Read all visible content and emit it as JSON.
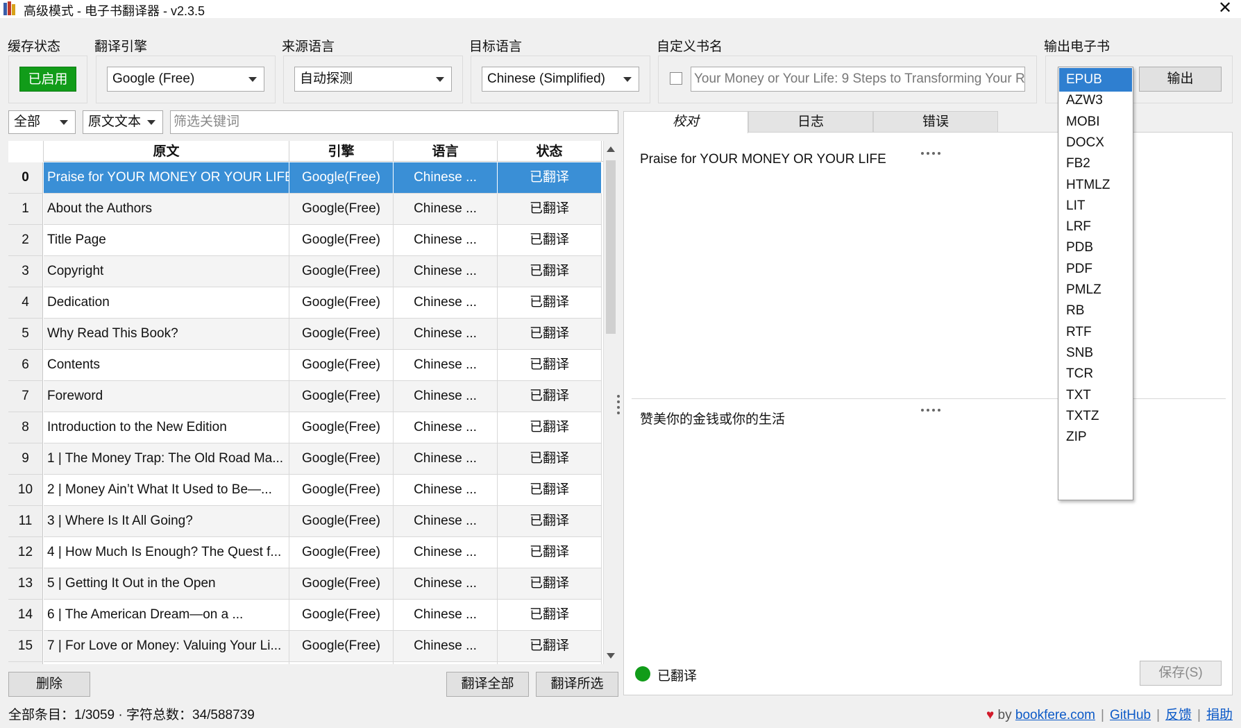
{
  "window": {
    "title": "高级模式 - 电子书翻译器 - v2.3.5",
    "close_symbol": "✕"
  },
  "cache": {
    "label": "缓存状态",
    "button": "已启用",
    "color": "#119c19"
  },
  "engine": {
    "label": "翻译引擎",
    "value": "Google (Free)"
  },
  "source_lang": {
    "label": "来源语言",
    "value": "自动探测"
  },
  "target_lang": {
    "label": "目标语言",
    "value": "Chinese (Simplified)"
  },
  "custom_title": {
    "label": "自定义书名",
    "checked": false,
    "value": "Your Money or Your Life: 9 Steps to Transforming Your R"
  },
  "output": {
    "label": "输出电子书",
    "selected_format": "EPUB",
    "button": "输出",
    "formats": [
      "EPUB",
      "AZW3",
      "MOBI",
      "DOCX",
      "FB2",
      "HTMLZ",
      "LIT",
      "LRF",
      "PDB",
      "PDF",
      "PMLZ",
      "RB",
      "RTF",
      "SNB",
      "TCR",
      "TXT",
      "TXTZ",
      "ZIP"
    ]
  },
  "filters": {
    "scope": "全部",
    "field": "原文文本",
    "placeholder": "筛选关键词"
  },
  "table": {
    "headers": {
      "source": "原文",
      "engine": "引擎",
      "language": "语言",
      "status": "状态"
    },
    "selected_row": 0,
    "rows": [
      {
        "idx": "0",
        "source": "Praise for YOUR MONEY OR YOUR LIFE",
        "engine": "Google(Free)",
        "language": "Chinese ...",
        "status": "已翻译"
      },
      {
        "idx": "1",
        "source": "About the Authors",
        "engine": "Google(Free)",
        "language": "Chinese ...",
        "status": "已翻译"
      },
      {
        "idx": "2",
        "source": "Title Page",
        "engine": "Google(Free)",
        "language": "Chinese ...",
        "status": "已翻译"
      },
      {
        "idx": "3",
        "source": "Copyright",
        "engine": "Google(Free)",
        "language": "Chinese ...",
        "status": "已翻译"
      },
      {
        "idx": "4",
        "source": "Dedication",
        "engine": "Google(Free)",
        "language": "Chinese ...",
        "status": "已翻译"
      },
      {
        "idx": "5",
        "source": "Why Read This Book?",
        "engine": "Google(Free)",
        "language": "Chinese ...",
        "status": "已翻译"
      },
      {
        "idx": "6",
        "source": "Contents",
        "engine": "Google(Free)",
        "language": "Chinese ...",
        "status": "已翻译"
      },
      {
        "idx": "7",
        "source": "Foreword",
        "engine": "Google(Free)",
        "language": "Chinese ...",
        "status": "已翻译"
      },
      {
        "idx": "8",
        "source": "Introduction to the New Edition",
        "engine": "Google(Free)",
        "language": "Chinese ...",
        "status": "已翻译"
      },
      {
        "idx": "9",
        "source": "1 | The Money Trap: The Old Road Ma...",
        "engine": "Google(Free)",
        "language": "Chinese ...",
        "status": "已翻译"
      },
      {
        "idx": "10",
        "source": "2 | Money Ain’t What It Used to Be—...",
        "engine": "Google(Free)",
        "language": "Chinese ...",
        "status": "已翻译"
      },
      {
        "idx": "11",
        "source": "3 | Where Is It All Going?",
        "engine": "Google(Free)",
        "language": "Chinese ...",
        "status": "已翻译"
      },
      {
        "idx": "12",
        "source": "4 | How Much Is Enough? The Quest f...",
        "engine": "Google(Free)",
        "language": "Chinese ...",
        "status": "已翻译"
      },
      {
        "idx": "13",
        "source": "5 | Getting It Out in the Open",
        "engine": "Google(Free)",
        "language": "Chinese ...",
        "status": "已翻译"
      },
      {
        "idx": "14",
        "source": "6 | The American Dream—on a ...",
        "engine": "Google(Free)",
        "language": "Chinese ...",
        "status": "已翻译"
      },
      {
        "idx": "15",
        "source": "7 | For Love or Money: Valuing Your Li...",
        "engine": "Google(Free)",
        "language": "Chinese ...",
        "status": "已翻译"
      },
      {
        "idx": "16",
        "source": "",
        "engine": "",
        "language": "",
        "status": ""
      }
    ]
  },
  "actions": {
    "delete": "删除",
    "translate_all": "翻译全部",
    "translate_selected": "翻译所选"
  },
  "tabs": {
    "review": "校对",
    "log": "日志",
    "errors": "错误"
  },
  "review": {
    "source_text": "Praise for YOUR MONEY OR YOUR LIFE",
    "translated_text": "赞美你的金钱或你的生活",
    "status": "已翻译",
    "status_color": "#119c19",
    "save": "保存(S)"
  },
  "footer": {
    "summary": "全部条目：1/3059 · 字符总数：34/588739",
    "heart": "♥",
    "by": "by",
    "site": "bookfere.com",
    "github": "GitHub",
    "feedback": "反馈",
    "donate": "捐助",
    "sep": "|"
  }
}
